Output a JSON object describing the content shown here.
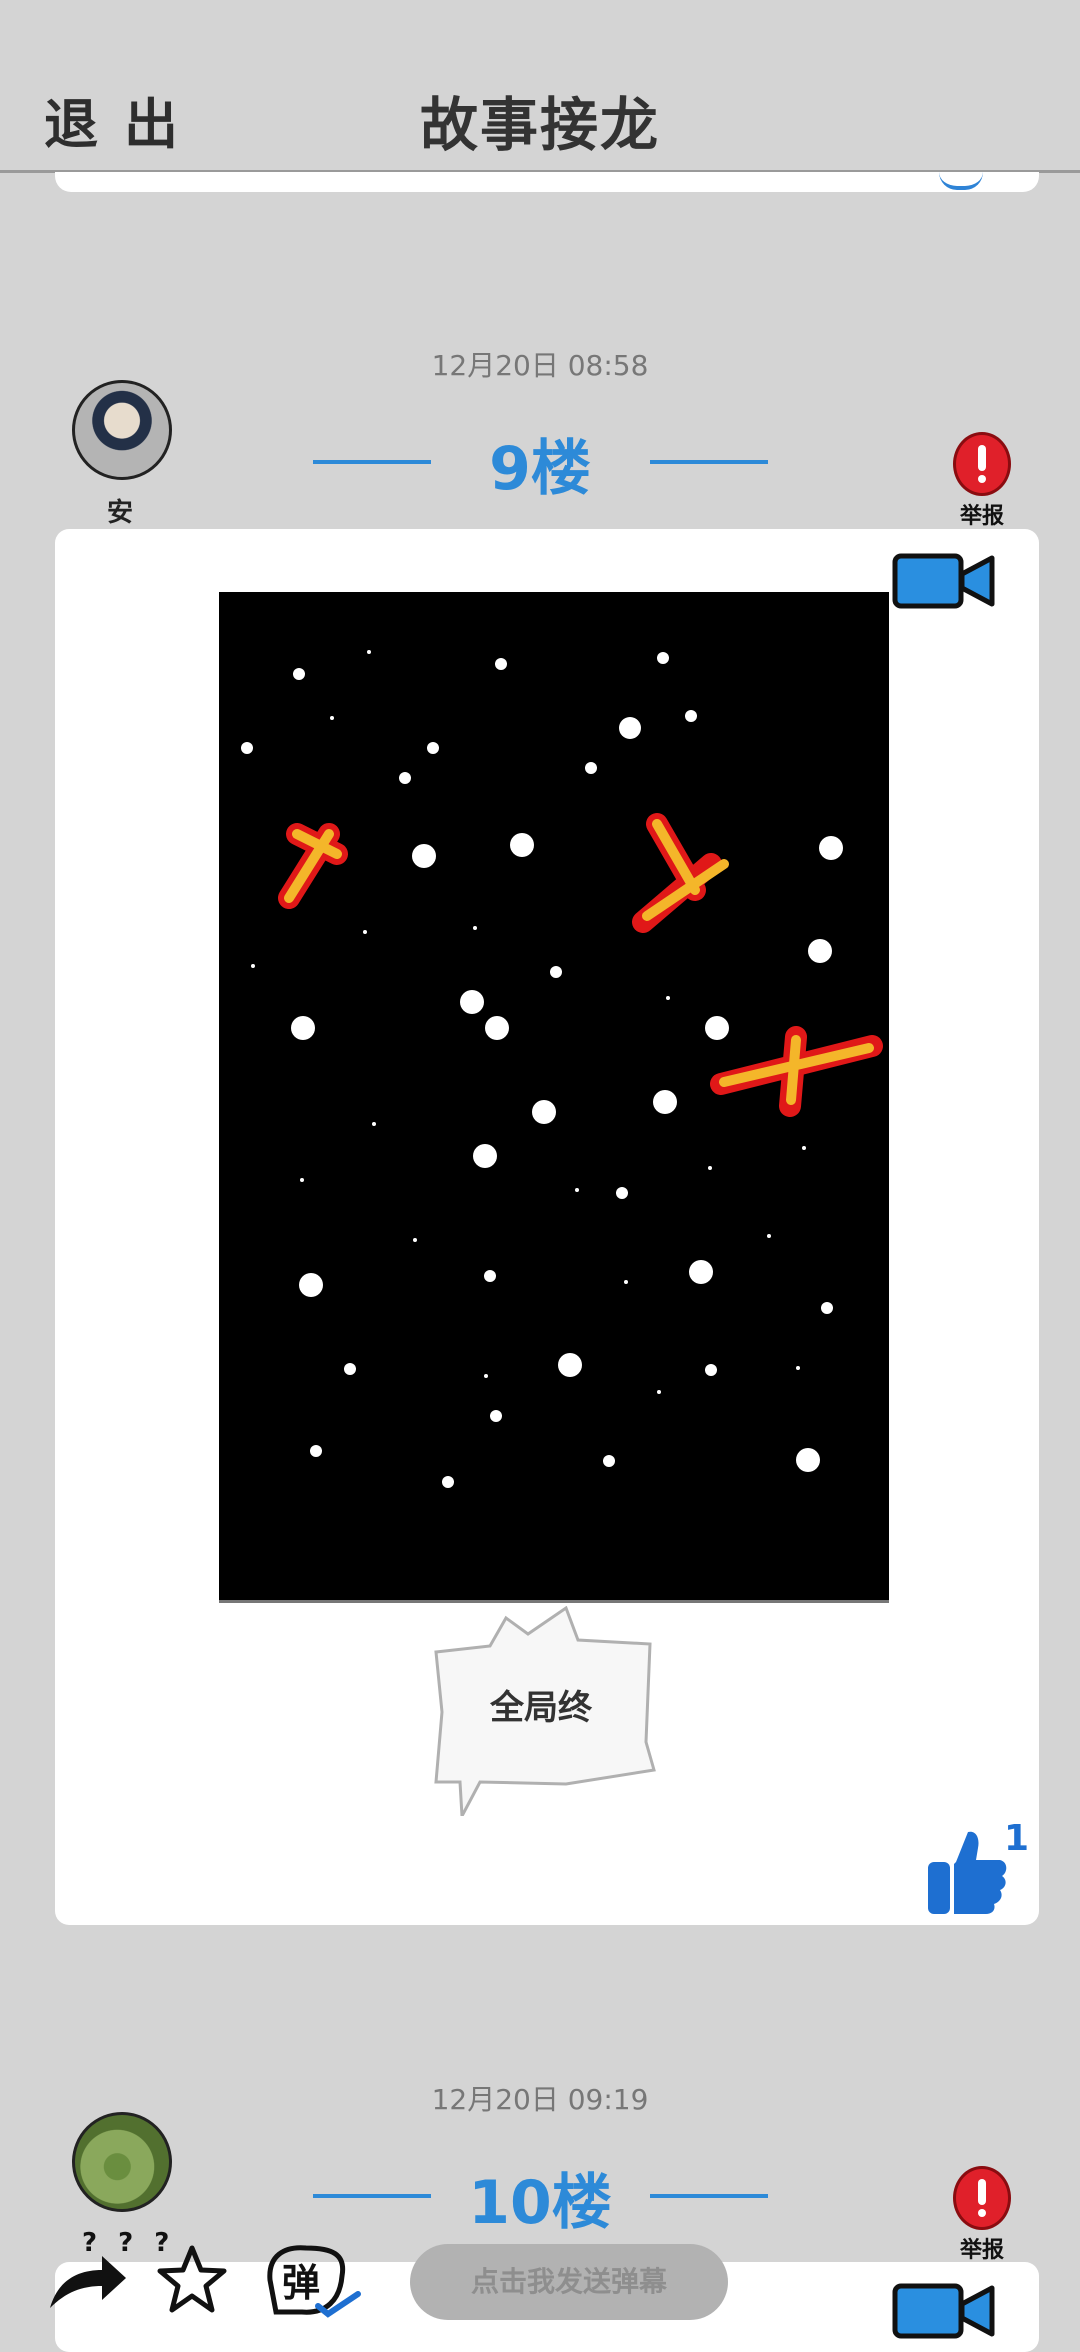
{
  "header": {
    "exit_label": "退出",
    "title": "故事接龙"
  },
  "posts": [
    {
      "timestamp": "12月20日  08:58",
      "floor_label": "9楼",
      "author": "安",
      "report_label": "举报",
      "caption": "全局终",
      "likes": "1"
    },
    {
      "timestamp": "12月20日  09:19",
      "floor_label": "10楼",
      "author": "? ? ?",
      "report_label": "举报"
    }
  ],
  "toolbar": {
    "danmu_placeholder": "点击我发送弹幕",
    "danmu_icon_char": "弹"
  },
  "colors": {
    "accent": "#2d8ad8",
    "background": "#d4d4d4",
    "report": "#e0202a",
    "like": "#1e6fd1"
  }
}
